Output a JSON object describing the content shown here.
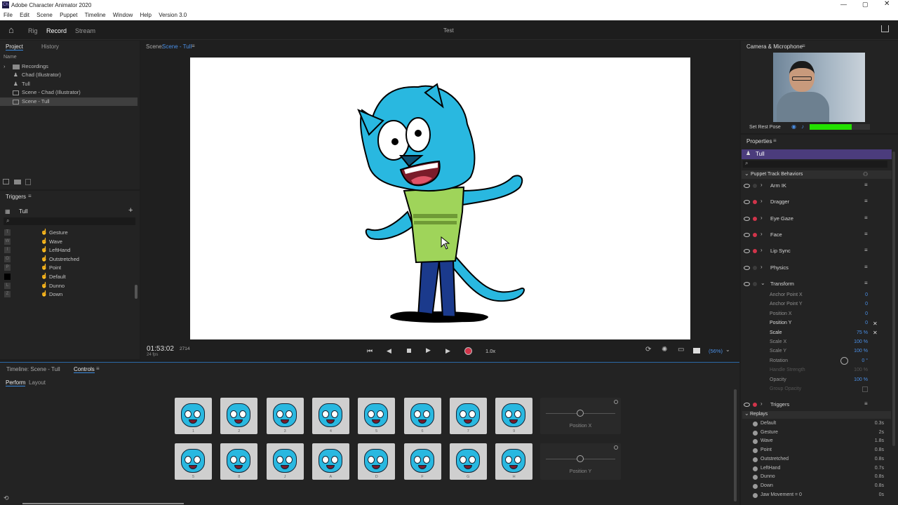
{
  "window": {
    "title": "Adobe Character Animator 2020"
  },
  "menu": [
    "File",
    "Edit",
    "Scene",
    "Puppet",
    "Timeline",
    "Window",
    "Help",
    "Version 3.0"
  ],
  "modes": {
    "rig": "Rig",
    "record": "Record",
    "stream": "Stream"
  },
  "doc_title": "Test",
  "project": {
    "tab_project": "Project",
    "tab_history": "History",
    "col_name": "Name",
    "items": [
      "Recordings",
      "Chad (Illustrator)",
      "Tull",
      "Scene - Chad (Illustrator)",
      "Scene - Tull"
    ]
  },
  "triggers": {
    "title": "Triggers",
    "puppet": "Tull",
    "items": [
      {
        "key": "T",
        "label": "Gesture"
      },
      {
        "key": "W",
        "label": "Wave"
      },
      {
        "key": "I",
        "label": "LeftHand"
      },
      {
        "key": "O",
        "label": "Outstretched"
      },
      {
        "key": "P",
        "label": "Point"
      },
      {
        "key": "",
        "label": "Default"
      },
      {
        "key": "L",
        "label": "Dunno"
      },
      {
        "key": "Z",
        "label": "Down"
      }
    ]
  },
  "scene": {
    "label": "Scene:",
    "name": "Scene - Tull"
  },
  "transport": {
    "timecode": "01:53:02",
    "frame": "2714",
    "fps": "24 fps",
    "speed": "1.0x",
    "zoom": "(56%)"
  },
  "timeline": {
    "tab_timeline": "Timeline: Scene - Tull",
    "tab_controls": "Controls",
    "perform": "Perform",
    "layout": "Layout"
  },
  "controls_row1": [
    "1",
    "2",
    "3",
    "4",
    "5",
    "6",
    "7",
    "9"
  ],
  "controls_row2": [
    "5",
    "8",
    "J",
    "A",
    "D",
    "F",
    "G",
    "H"
  ],
  "sliders": [
    "Position X",
    "Position Y"
  ],
  "camera": {
    "title": "Camera & Microphone",
    "rest_pose": "Set Rest Pose"
  },
  "properties": {
    "title": "Properties",
    "puppet": "Tull",
    "section": "Puppet Track Behaviors",
    "behaviors": [
      {
        "name": "Arm IK",
        "armed": false
      },
      {
        "name": "Dragger",
        "armed": true
      },
      {
        "name": "Eye Gaze",
        "armed": true
      },
      {
        "name": "Face",
        "armed": true
      },
      {
        "name": "Lip Sync",
        "armed": true
      },
      {
        "name": "Physics",
        "armed": false
      },
      {
        "name": "Transform",
        "armed": false
      }
    ],
    "transform": [
      {
        "label": "Anchor Point X",
        "value": "0",
        "hi": false
      },
      {
        "label": "Anchor Point Y",
        "value": "0",
        "hi": false
      },
      {
        "label": "Position X",
        "value": "0",
        "hi": false
      },
      {
        "label": "Position Y",
        "value": "0",
        "hi": true
      },
      {
        "label": "Scale",
        "value": "75 %",
        "hi": true
      },
      {
        "label": "Scale X",
        "value": "100 %",
        "hi": false
      },
      {
        "label": "Scale Y",
        "value": "100 %",
        "hi": false
      },
      {
        "label": "Rotation",
        "value": "0 °",
        "hi": false
      },
      {
        "label": "Handle Strength",
        "value": "100 %",
        "hi": false
      },
      {
        "label": "Opacity",
        "value": "100 %",
        "hi": false
      },
      {
        "label": "Group Opacity",
        "value": "",
        "hi": false
      }
    ],
    "triggers_label": "Triggers",
    "replays_label": "Replays",
    "replays": [
      {
        "name": "Default",
        "dur": "0.3s"
      },
      {
        "name": "Gesture",
        "dur": "2s"
      },
      {
        "name": "Wave",
        "dur": "1.8s"
      },
      {
        "name": "Point",
        "dur": "0.8s"
      },
      {
        "name": "Outstretched",
        "dur": "0.8s"
      },
      {
        "name": "LeftHand",
        "dur": "0.7s"
      },
      {
        "name": "Dunno",
        "dur": "0.8s"
      },
      {
        "name": "Down",
        "dur": "0.8s"
      },
      {
        "name": "Jaw Movement = 0",
        "dur": "0s"
      }
    ]
  },
  "colors": {
    "accent": "#4a8fe6",
    "cyan": "#29b8e0",
    "shirt": "#9fd45a",
    "record": "#d1344a",
    "audio": "#22e000"
  }
}
